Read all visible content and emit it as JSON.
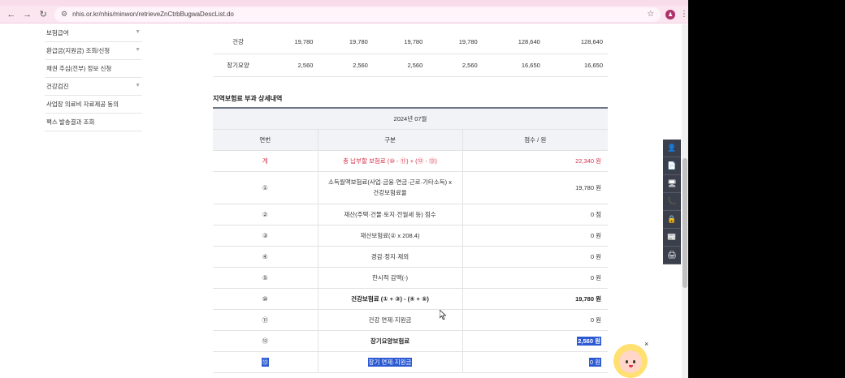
{
  "browser": {
    "url": "nhis.or.kr/nhis/minwon/retrieveZnCtrbBugwaDescList.do",
    "profile_initial": "♟"
  },
  "sidebar": {
    "items": [
      {
        "label": "보험급여",
        "chevron": true
      },
      {
        "label": "환급금(지원금) 조회/신청",
        "chevron": true
      },
      {
        "label": "채권 추심(전부) 정보 신청",
        "chevron": false
      },
      {
        "label": "건강검진",
        "chevron": true
      },
      {
        "label": "사업장 의료비 자료제공 동의",
        "chevron": false
      },
      {
        "label": "팩스 발송결과 조회",
        "chevron": false
      }
    ]
  },
  "top_table": {
    "rows": [
      {
        "category": "건강",
        "values": [
          "19,780",
          "19,780",
          "19,780",
          "19,780",
          "128,640",
          "128,640"
        ]
      },
      {
        "category": "장기요양",
        "values": [
          "2,560",
          "2,560",
          "2,560",
          "2,560",
          "16,650",
          "16,650"
        ]
      }
    ]
  },
  "detail": {
    "section_title": "지역보험료 부과 상세내역",
    "period": "2024년 07월",
    "headers": [
      "연번",
      "구분",
      "점수 / 원"
    ],
    "rows": [
      {
        "no": "계",
        "label": "총 납부할 보험료 (⑩ - ⑪) + (⑫ - ⑬)",
        "value": "22,340 원",
        "style": "total"
      },
      {
        "no": "①",
        "label": "소득월액보험료(사업·금융·연금·근로·기타소득) x 건강보험료율",
        "value": "19,780 원",
        "style": ""
      },
      {
        "no": "②",
        "label": "재산(주택·건물·토지·전월세 등) 점수",
        "value": "0 점",
        "style": ""
      },
      {
        "no": "③",
        "label": "재산보험료(② x 208.4)",
        "value": "0 원",
        "style": ""
      },
      {
        "no": "④",
        "label": "경감·정지·제외",
        "value": "0 원",
        "style": ""
      },
      {
        "no": "⑤",
        "label": "한시적 감액(-)",
        "value": "0 원",
        "style": ""
      },
      {
        "no": "⑩",
        "label": "건강보험료 (① + ③) - (④ + ⑤)",
        "value": "19,780 원",
        "style": "bold"
      },
      {
        "no": "⑪",
        "label": "건강 면제·지원금",
        "value": "0 원",
        "style": ""
      },
      {
        "no": "⑫",
        "label": "장기요양보험료",
        "value": "2,560 원",
        "style": "bold sel-value"
      },
      {
        "no": "⑬",
        "label": "장기 면제·지원금",
        "value": "0 원",
        "style": "sel-all"
      }
    ]
  },
  "quick_menu": [
    "person-icon",
    "document-icon",
    "monitor-icon",
    "phone-icon",
    "lock-icon",
    "news-icon",
    "print-icon"
  ],
  "quick_menu_glyphs": [
    "👤",
    "📄",
    "🖥",
    "📞",
    "🔒",
    "📰",
    "🖨"
  ],
  "mascot": {
    "close": "×"
  }
}
